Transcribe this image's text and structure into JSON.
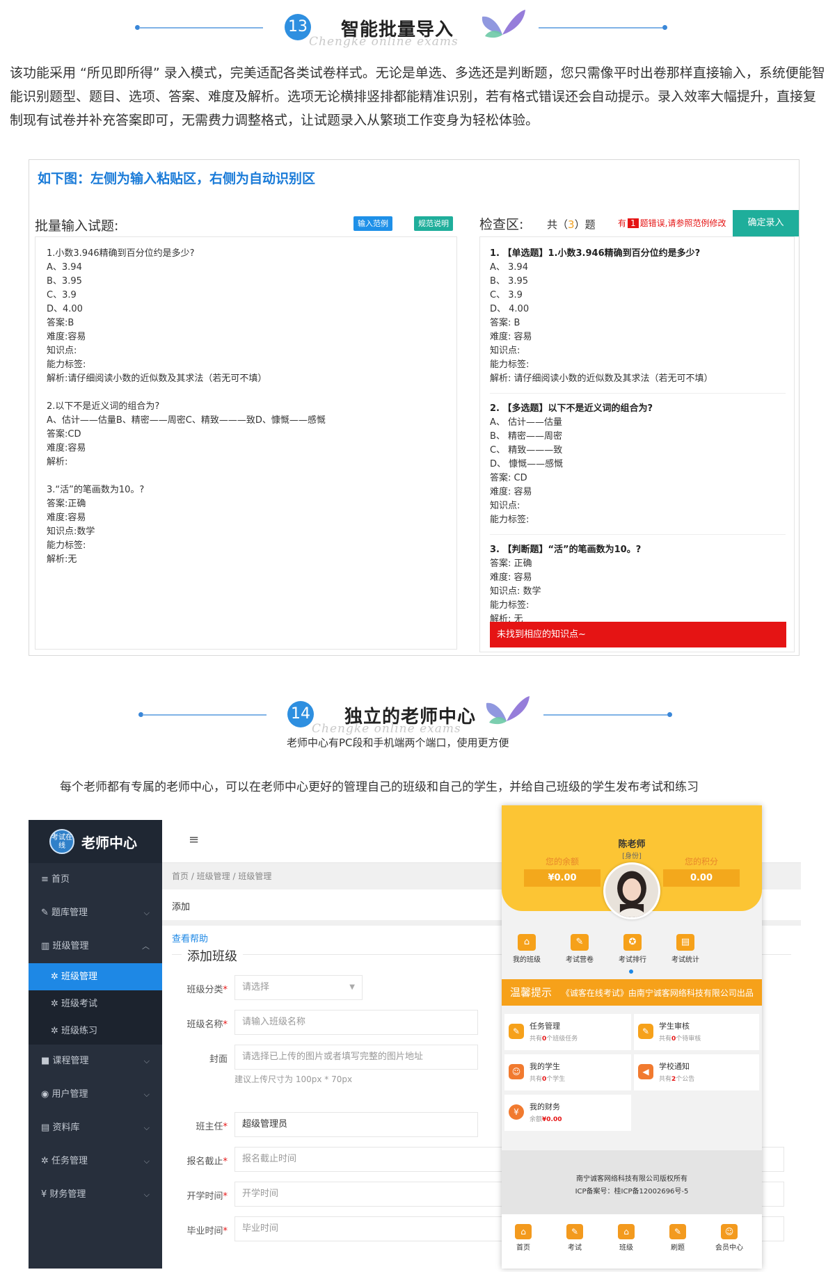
{
  "section13": {
    "number": "13",
    "title": "智能批量导入",
    "watermark": "Chengke online exams",
    "intro": "该功能采用 “所见即所得” 录入模式，完美适配各类试卷样式。无论是单选、多选还是判断题，您只需像平时出卷那样直接输入，系统便能智能识别题型、题目、选项、答案、难度及解析。选项无论横排竖排都能精准识别，若有格式错误还会自动提示。录入效率大幅提升，直接复制现有试卷并补充答案即可，无需费力调整格式，让试题录入从繁琐工作变身为轻松体验。"
  },
  "demo": {
    "heading": "如下图：左侧为输入粘贴区，右侧为自动识别区",
    "left_title": "批量输入试题:",
    "btn_example": "输入范例",
    "btn_spec": "规范说明",
    "right_title": "检查区:",
    "count_prefix": "共（",
    "count": "3",
    "count_suffix": "）题",
    "err_prefix": "有",
    "err_count": "1",
    "err_suffix": "题错误,请参照范例修改",
    "confirm": "确定录入",
    "paste_text": "1.小数3.946精确到百分位约是多少?\nA、3.94\nB、3.95\nC、3.9\nD、4.00\n答案:B\n难度:容易\n知识点:\n能力标签:\n解析:请仔细阅读小数的近似数及其求法（若无可不填）\n\n2.以下不是近义词的组合为?\nA、估计——估量B、精密——周密C、精致———致D、慷慨——感慨\n答案:CD\n难度:容易\n解析:\n\n3.“活”的笔画数为10。?\n答案:正确\n难度:容易\n知识点:数学\n能力标签:\n解析:无",
    "questions": [
      {
        "title": "1. 【单选题】1.小数3.946精确到百分位约是多少?",
        "lines": "A、 3.94\nB、 3.95\nC、 3.9\nD、 4.00\n答案: B\n难度: 容易\n知识点:\n能力标签:\n解析: 请仔细阅读小数的近似数及其求法（若无可不填）"
      },
      {
        "title": "2. 【多选题】以下不是近义词的组合为?",
        "lines": "A、 估计——估量\nB、 精密——周密\nC、 精致———致\nD、 慷慨——感慨\n答案: CD\n难度: 容易\n知识点:\n能力标签:"
      },
      {
        "title": "3. 【判断题】“活”的笔画数为10。?",
        "lines": "答案: 正确\n难度: 容易\n知识点: 数学\n能力标签:\n解析: 无"
      }
    ],
    "error_bar": "未找到相应的知识点~"
  },
  "section14": {
    "number": "14",
    "title": "独立的老师中心",
    "watermark": "Chengke online exams",
    "subtitle": "老师中心有PC段和手机端两个端口，使用更方便",
    "desc": "每个老师都有专属的老师中心，可以在老师中心更好的管理自己的班级和自己的学生，并给自己班级的学生发布考试和练习"
  },
  "pc": {
    "logo_badge": "考试在线",
    "logo_text": "老师中心",
    "menu": [
      {
        "icon": "≡",
        "label": "首页",
        "arrow": ""
      },
      {
        "icon": "✎",
        "label": "题库管理",
        "arrow": "⌵"
      },
      {
        "icon": "▥",
        "label": "班级管理",
        "arrow": "︿"
      }
    ],
    "submenu": [
      "✲ 班级管理",
      "✲ 班级考试",
      "✲ 班级练习"
    ],
    "menu2": [
      {
        "icon": "■",
        "label": "课程管理"
      },
      {
        "icon": "◉",
        "label": "用户管理"
      },
      {
        "icon": "▤",
        "label": "资料库"
      },
      {
        "icon": "✲",
        "label": "任务管理"
      },
      {
        "icon": "¥",
        "label": "财务管理"
      }
    ],
    "arrow": "⌵",
    "hamburger": "≡",
    "crumb": "首页  /  班级管理  /  班级管理",
    "tab_add": "添加",
    "help": "查看帮助",
    "form_title": "添加班级",
    "fields": {
      "category_label": "班级分类",
      "category_placeholder": "请选择",
      "name_label": "班级名称",
      "name_placeholder": "请输入班级名称",
      "cover_label": "封面",
      "cover_placeholder": "请选择已上传的图片或者填写完整的图片地址",
      "cover_hint": "建议上传尺寸为 100px * 70px",
      "head_label": "班主任",
      "head_value": "超级管理员",
      "deadline_label": "报名截止",
      "deadline_placeholder": "报名截止时间",
      "start_label": "开学时间",
      "start_placeholder": "开学时间",
      "grad_label": "毕业时间",
      "grad_placeholder": "毕业时间"
    }
  },
  "mobile": {
    "name": "陈老师",
    "role": "[身份]",
    "balance_label": "您的余额",
    "balance": "¥0.00",
    "points_label": "您的积分",
    "points": "0.00",
    "grid": [
      {
        "icon": "⌂",
        "label": "我的班级"
      },
      {
        "icon": "✎",
        "label": "考试营卷"
      },
      {
        "icon": "✪",
        "label": "考试排行"
      },
      {
        "icon": "▤",
        "label": "考试统计"
      }
    ],
    "notice_label": "温馨提示",
    "notice_text": "《诚客在线考试》由南宁诚客网络科技有限公司出品",
    "cards": [
      {
        "icon": "✎",
        "title": "任务管理",
        "sub_pre": "共有",
        "sub_num": "0",
        "sub_post": "个班级任务",
        "color": "#f6a11a"
      },
      {
        "icon": "✎",
        "title": "学生审核",
        "sub_pre": "共有",
        "sub_num": "0",
        "sub_post": "个待审核",
        "color": "#f6a11a"
      },
      {
        "icon": "☺",
        "title": "我的学生",
        "sub_pre": "共有",
        "sub_num": "0",
        "sub_post": "个学生",
        "color": "#f17a2f"
      },
      {
        "icon": "◀",
        "title": "学校通知",
        "sub_pre": "共有",
        "sub_num": "2",
        "sub_post": "个公告",
        "color": "#f17a2f"
      },
      {
        "icon": "¥",
        "title": "我的财务",
        "sub_pre": "余额",
        "sub_num": "¥0.00",
        "sub_post": "",
        "color": "#f17a2f"
      }
    ],
    "footer1": "南宁诚客网络科技有限公司版权所有",
    "footer2": "ICP备案号：桂ICP备12002696号-5",
    "tabs": [
      {
        "icon": "⌂",
        "label": "首页"
      },
      {
        "icon": "✎",
        "label": "考试"
      },
      {
        "icon": "⌂",
        "label": "班级"
      },
      {
        "icon": "✎",
        "label": "刷题"
      },
      {
        "icon": "☺",
        "label": "会员中心"
      }
    ]
  },
  "colors": {
    "accent": "#1a7bd8",
    "teal": "#1fae9b",
    "red": "#e51414",
    "yellow": "#fcc534",
    "sidebar": "#272f3c"
  }
}
